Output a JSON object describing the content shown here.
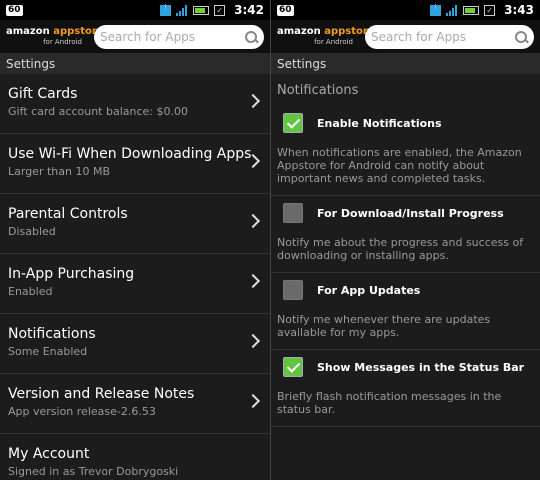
{
  "left": {
    "status": {
      "badge": "60",
      "time": "3:42"
    },
    "logo": {
      "main_plain": "amazon",
      "main_accent": "appstore",
      "sub": "for Android"
    },
    "search": {
      "placeholder": "Search for Apps"
    },
    "section_title": "Settings",
    "items": [
      {
        "title": "Gift Cards",
        "subtitle": "Gift card account balance: $0.00"
      },
      {
        "title": "Use Wi-Fi When Downloading Apps",
        "subtitle": "Larger than 10  MB"
      },
      {
        "title": "Parental Controls",
        "subtitle": "Disabled"
      },
      {
        "title": "In-App Purchasing",
        "subtitle": "Enabled"
      },
      {
        "title": "Notifications",
        "subtitle": "Some Enabled"
      },
      {
        "title": "Version and Release Notes",
        "subtitle": "App version release-2.6.53"
      },
      {
        "title": "My Account",
        "subtitle": "Signed in as Trevor Dobrygoski"
      }
    ]
  },
  "right": {
    "status": {
      "badge": "60",
      "time": "3:43"
    },
    "logo": {
      "main_plain": "amazon",
      "main_accent": "appstore",
      "sub": "for Android"
    },
    "search": {
      "placeholder": "Search for Apps"
    },
    "section_title": "Settings",
    "page_title": "Notifications",
    "prefs": [
      {
        "label": "Enable Notifications",
        "checked": true,
        "desc": "When notifications are enabled, the Amazon Appstore for Android can notify about important news and completed tasks."
      },
      {
        "label": "For Download/Install Progress",
        "checked": false,
        "desc": "Notify me about the progress and success of downloading or installing apps."
      },
      {
        "label": "For App Updates",
        "checked": false,
        "desc": "Notify me whenever there are updates available for my apps."
      },
      {
        "label": "Show Messages in the Status Bar",
        "checked": true,
        "desc": "Briefly flash notification messages in the status bar."
      }
    ]
  },
  "colors": {
    "accent": "#f29b1e",
    "check_on": "#63c443"
  }
}
